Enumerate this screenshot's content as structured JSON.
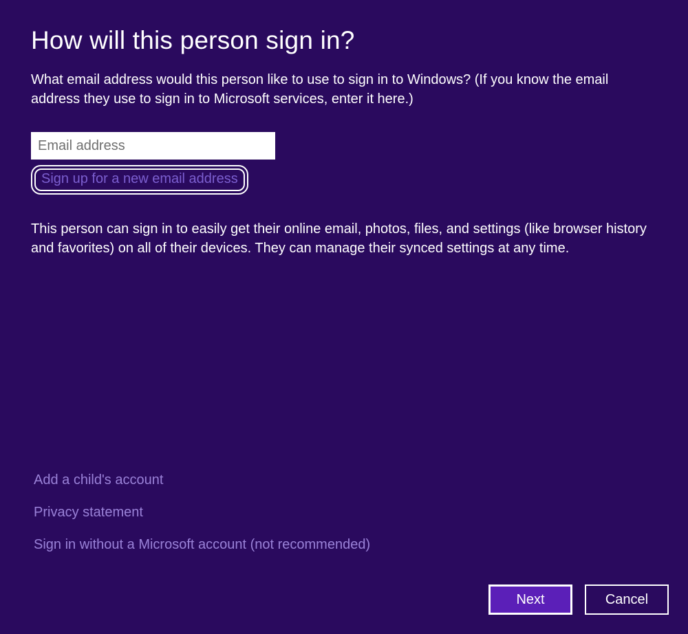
{
  "header": {
    "title": "How will this person sign in?"
  },
  "intro": "What email address would this person like to use to sign in to Windows? (If you know the email address they use to sign in to Microsoft services, enter it here.)",
  "email": {
    "value": "",
    "placeholder": "Email address"
  },
  "signup_link": "Sign up for a new email address",
  "benefit": "This person can sign in to easily get their online email, photos, files, and settings (like browser history and favorites) on all of their devices. They can manage their synced settings at any time.",
  "links": {
    "child_account": "Add a child's account",
    "privacy": "Privacy statement",
    "no_ms_account": "Sign in without a Microsoft account (not recommended)"
  },
  "buttons": {
    "next": "Next",
    "cancel": "Cancel"
  }
}
